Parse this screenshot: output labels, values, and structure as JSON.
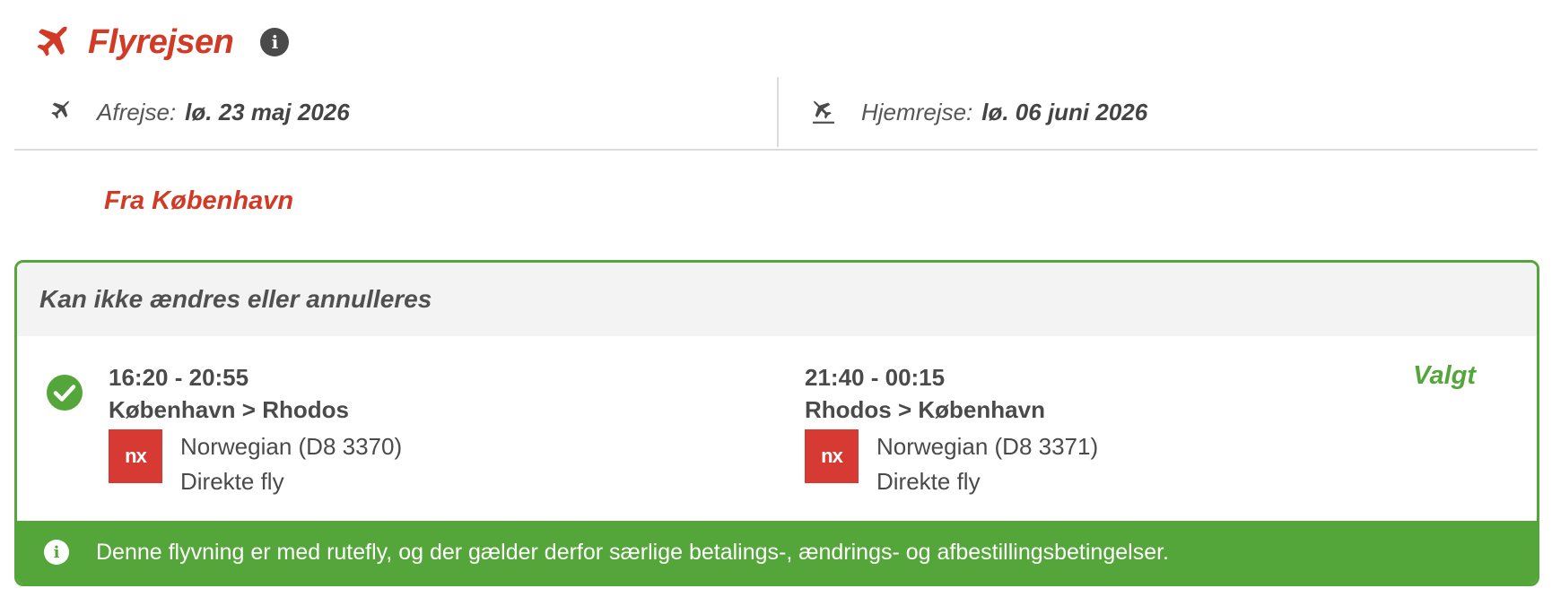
{
  "header": {
    "title": "Flyrejsen",
    "info_icon": "info-icon",
    "plane_icon": "airplane-icon",
    "accent_color": "#d23a26"
  },
  "dates": {
    "departure": {
      "label": "Afrejse:",
      "value": "lø. 23 maj 2026",
      "icon": "departure-plane-icon"
    },
    "return": {
      "label": "Hjemrejse:",
      "value": "lø. 06 juni 2026",
      "icon": "arrival-plane-icon"
    }
  },
  "from_heading": "Fra København",
  "card": {
    "header_text": "Kan ikke ændres eller annulleres",
    "selected_label": "Valgt",
    "selected_icon": "check-circle-icon",
    "border_color": "#55a63a",
    "outbound": {
      "time": "16:20 - 20:55",
      "route": "København > Rhodos",
      "airline": "Norwegian (D8 3370)",
      "flight_type": "Direkte fly",
      "logo_text": "nx"
    },
    "homebound": {
      "time": "21:40 - 00:15",
      "route": "Rhodos > København",
      "airline": "Norwegian (D8 3371)",
      "flight_type": "Direkte fly",
      "logo_text": "nx"
    },
    "footer_text": "Denne flyvning er med rutefly, og der gælder derfor særlige betalings-, ændrings- og afbestillingsbetingelser.",
    "footer_icon": "info-icon"
  }
}
